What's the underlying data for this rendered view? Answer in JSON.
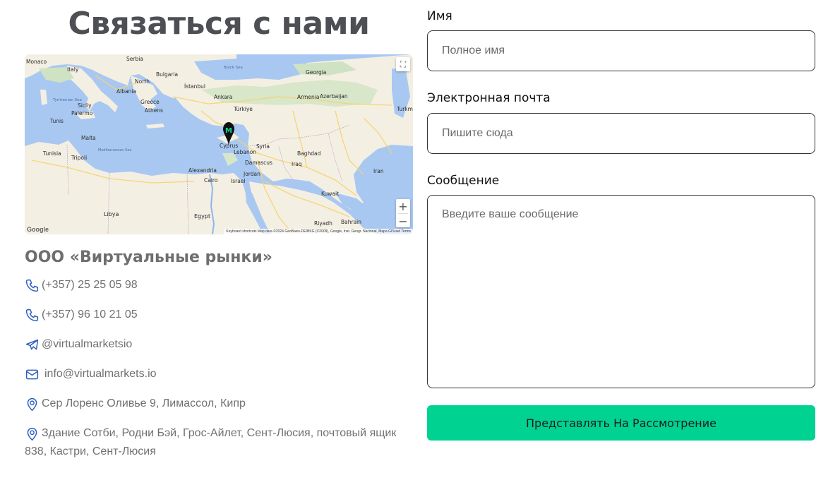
{
  "page": {
    "title": "Связаться с нами"
  },
  "map": {
    "labels": {
      "monaco": "Monaco",
      "serbia": "Serbia",
      "bulgaria": "Bulgaria",
      "italy": "Italy",
      "north": "North",
      "albania": "Albania",
      "istanbul": "İstanbul",
      "black_sea": "Black Sea",
      "georgia": "Georgia",
      "ankara": "Ankara",
      "armenia": "Armenia",
      "azerbaijan": "Azerbaijan",
      "tyrrhenian_sea": "Tyrrhenian Sea",
      "greece": "Greece",
      "turkiye": "Türkiye",
      "athens": "Athens",
      "sicily": "Sicily",
      "palermo": "Palermo",
      "tunis": "Tunis",
      "turkmen": "Turkme",
      "malta": "Malta",
      "cyprus": "Cyprus",
      "syria": "Syria",
      "mediterranean_sea": "Mediterranean Sea",
      "tunisia": "Tunisia",
      "tripoli": "Tripoli",
      "lebanon": "Lebanon",
      "baghdad": "Baghdad",
      "damascus": "Damascus",
      "iraq": "Iraq",
      "iran": "Iran",
      "alexandria": "Alexandria",
      "jordan": "Jordan",
      "cairo": "Cairo",
      "israel": "Israel",
      "kuwait": "Kuwait",
      "libya": "Libya",
      "egypt": "Egypt",
      "riyadh": "Riyadh",
      "bahrain": "Bahrain"
    },
    "fullscreen_icon": "fullscreen-icon",
    "zoom_in": "+",
    "zoom_out": "−",
    "logo": "Google",
    "attribution": "Keyboard shortcuts   Map data ©2024 GeoBasis-DE/BKG (©2009), Google, Inst. Geogr. Nacional, Mapa GISrael   Terms",
    "marker_letter": "M",
    "colors": {
      "water": "#a9c8f1",
      "land": "#f4efe3",
      "green": "#cfe3c4",
      "road": "#f7d36a",
      "marker": "#14d68f"
    }
  },
  "company": {
    "name": "ООО «Виртуальные рынки»"
  },
  "contacts": [
    {
      "icon": "phone-icon",
      "text": "(+357) 25 25 05 98"
    },
    {
      "icon": "phone-icon",
      "text": "(+357) 96 10 21 05"
    },
    {
      "icon": "telegram-icon",
      "text": "@virtualmarketsio"
    },
    {
      "icon": "mail-icon",
      "text": "info@virtualmarkets.io"
    },
    {
      "icon": "location-pin-icon",
      "text": "Сер Лоренс Оливье 9, Лимассол, Кипр"
    },
    {
      "icon": "location-pin-icon",
      "text": "Здание Сотби, Родни Бэй, Грос-Айлет, Сент-Люсия, почтовый ящик 838, Кастри, Сент-Люсия"
    }
  ],
  "form": {
    "name_label": "Имя",
    "name_placeholder": "Полное имя",
    "email_label": "Электронная почта",
    "email_placeholder": "Пишите сюда",
    "message_label": "Сообщение",
    "message_placeholder": "Введите ваше сообщение",
    "submit_label": "Представлять На Рассмотрение"
  },
  "colors": {
    "accent": "#00d291",
    "icon": "#2f5fbf",
    "title": "#4d4f54"
  }
}
